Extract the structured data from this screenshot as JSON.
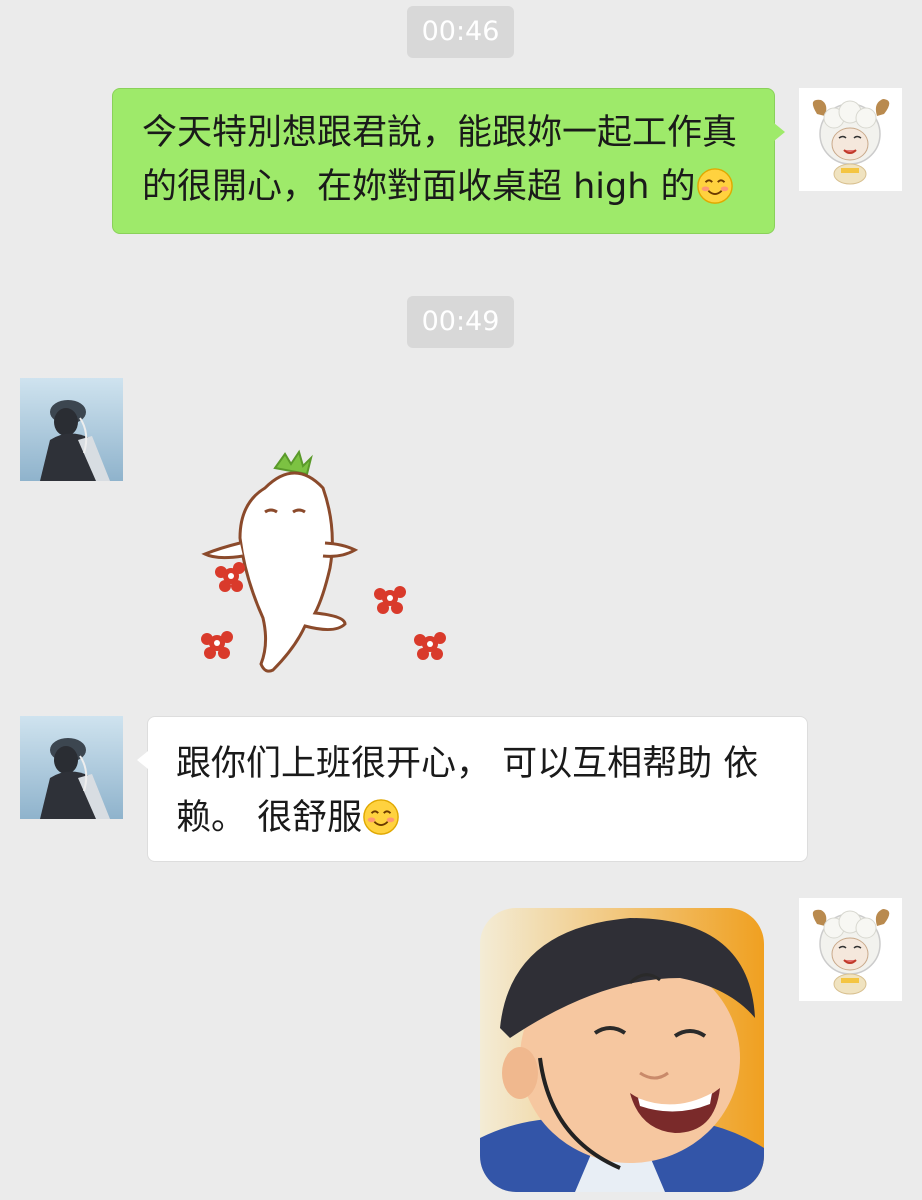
{
  "chat": {
    "timestamps": [
      "00:46",
      "00:49"
    ],
    "messages": [
      {
        "sender": "me",
        "text_line1": "今天特別想跟君說，能跟妳一起工作真",
        "text_line2": "的很開心，在妳對面收桌超 high 的",
        "emoji": "smiling-face-emoji"
      },
      {
        "sender": "friend",
        "type": "sticker",
        "sticker": "radish-dancing-sticker"
      },
      {
        "sender": "friend",
        "text_line1": "跟你们上班很开心， 可以互相帮助 依",
        "text_line2": "赖。 很舒服",
        "emoji": "smiling-face-emoji"
      },
      {
        "sender": "me",
        "type": "image",
        "image": "laughing-child-photo"
      }
    ]
  },
  "avatars": {
    "me": "sheep-cartoon-avatar",
    "friend": "person-photo-avatar"
  },
  "colors": {
    "background": "#ebebeb",
    "outgoing_bubble": "#9eea6a",
    "incoming_bubble": "#ffffff",
    "timestamp_bg": "#d8d8d8"
  }
}
